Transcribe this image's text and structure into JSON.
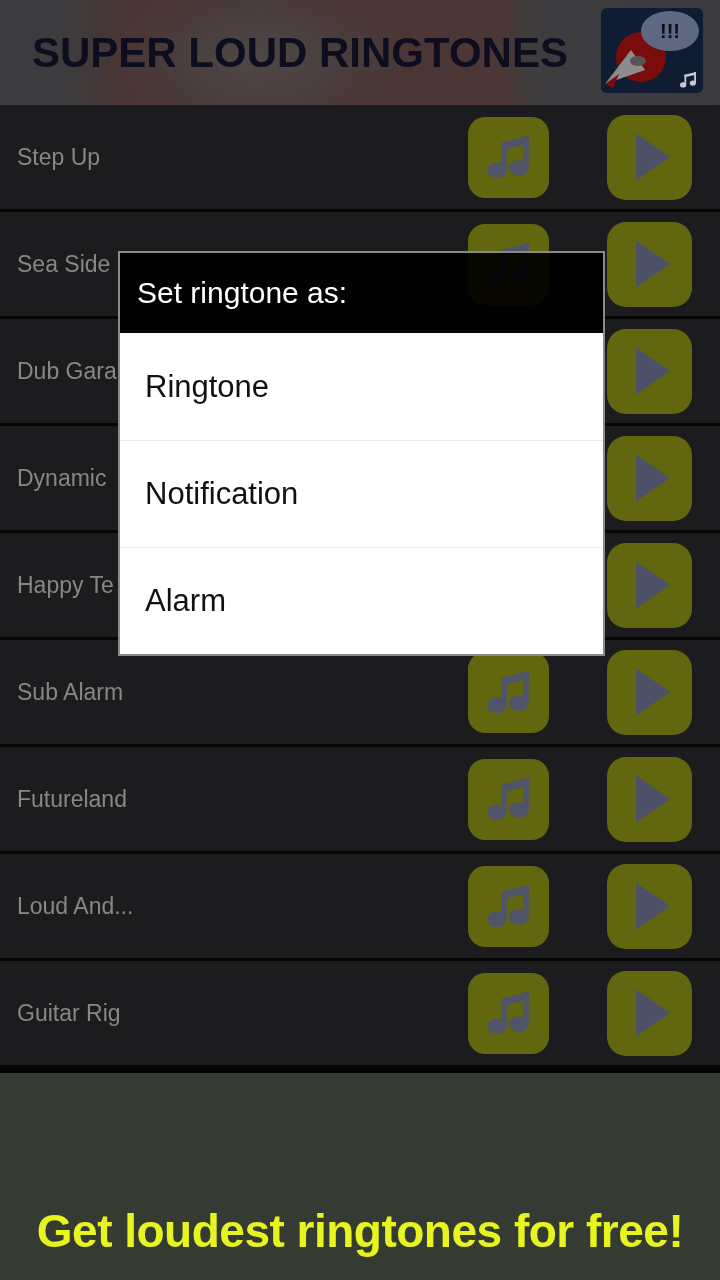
{
  "header": {
    "title": "SUPER LOUD RINGTONES",
    "logo_text": "!!!"
  },
  "ringtones": [
    {
      "title": "Step Up",
      "set_button_visible": true
    },
    {
      "title": "Sea Side",
      "set_button_visible": true
    },
    {
      "title": "Dub Gara",
      "set_button_visible": false
    },
    {
      "title": "Dynamic",
      "set_button_visible": false
    },
    {
      "title": "Happy Te",
      "set_button_visible": false
    },
    {
      "title": "Sub Alarm",
      "set_button_visible": true
    },
    {
      "title": "Futureland",
      "set_button_visible": true
    },
    {
      "title": "Loud And...",
      "set_button_visible": true
    },
    {
      "title": "Guitar Rig",
      "set_button_visible": true
    }
  ],
  "dialog": {
    "title": "Set ringtone as:",
    "options": [
      "Ringtone",
      "Notification",
      "Alarm"
    ]
  },
  "banner": {
    "text": "Get loudest ringtones for free!"
  }
}
